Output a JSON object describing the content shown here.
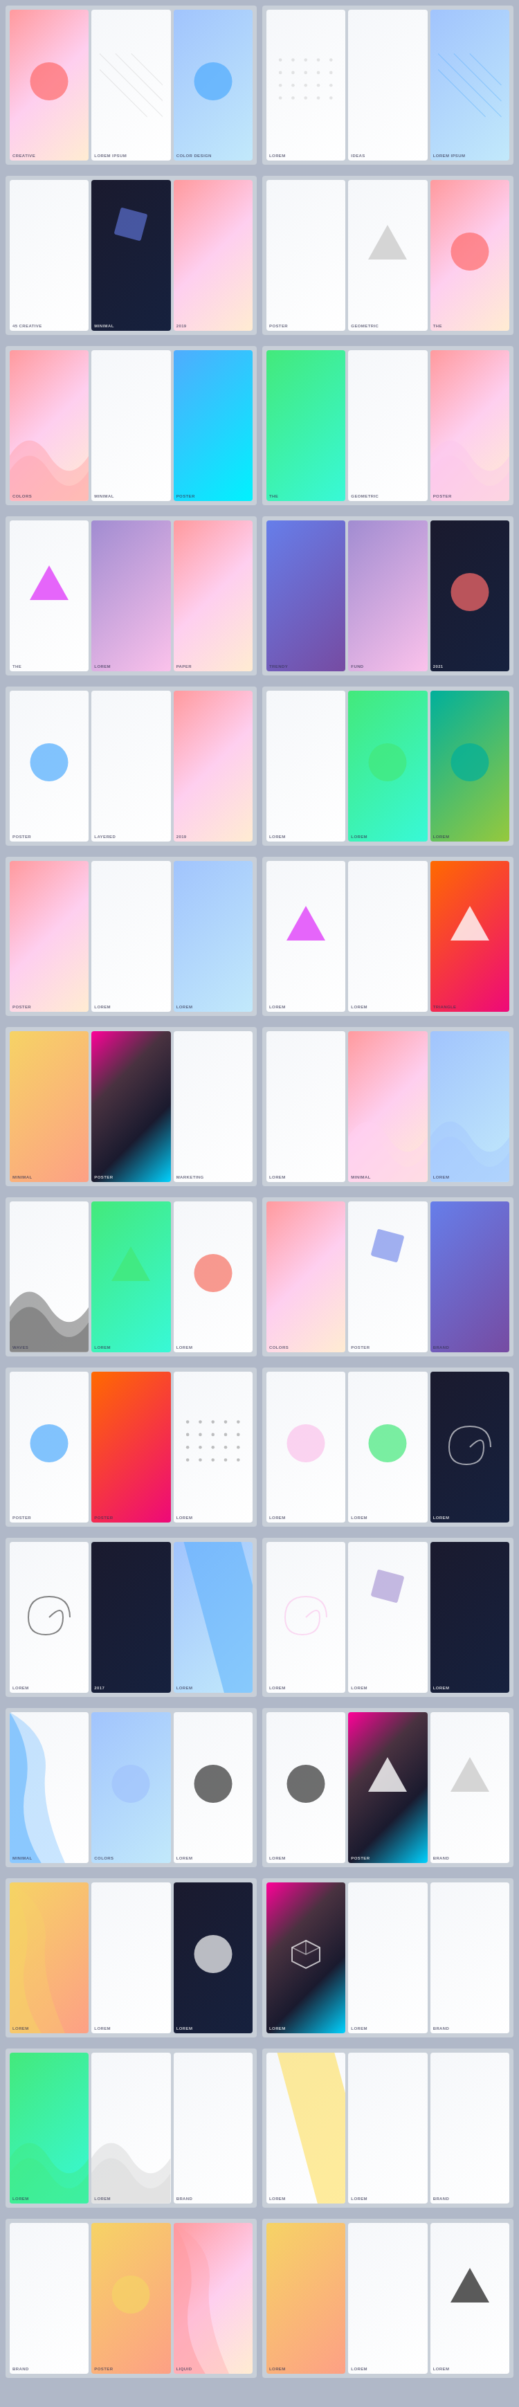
{
  "rows": [
    {
      "id": "row1",
      "cells": [
        {
          "id": "cell-1-1",
          "posters": [
            {
              "id": "p1",
              "label": "CREATIVE",
              "bg": "grad-warm",
              "shape": "circle",
              "shapeColor": "#ff6b6b"
            },
            {
              "id": "p2",
              "label": "LOREM IPSUM",
              "bg": "grad-light",
              "shape": "lines",
              "shapeColor": "#cccccc"
            },
            {
              "id": "p3",
              "label": "COLOR DESIGN",
              "bg": "grad-cool",
              "shape": "circle",
              "shapeColor": "#4facfe"
            }
          ]
        },
        {
          "id": "cell-1-2",
          "posters": [
            {
              "id": "p4",
              "label": "LOREM",
              "bg": "grad-light",
              "shape": "dots",
              "shapeColor": "#aaaaaa"
            },
            {
              "id": "p5",
              "label": "IDEAS",
              "bg": "grad-light",
              "shape": "none",
              "shapeColor": ""
            },
            {
              "id": "p6",
              "label": "LOREM IPSUM",
              "bg": "grad-cool",
              "shape": "lines",
              "shapeColor": "#4facfe"
            }
          ]
        }
      ]
    },
    {
      "id": "row2",
      "cells": [
        {
          "id": "cell-2-1",
          "posters": [
            {
              "id": "p7",
              "label": "45 CREATIVE",
              "bg": "grad-light",
              "shape": "none",
              "shapeColor": ""
            },
            {
              "id": "p8",
              "label": "MINIMAL",
              "bg": "grad-dark",
              "shape": "square",
              "shapeColor": "#667eea"
            },
            {
              "id": "p9",
              "label": "2019",
              "bg": "grad-warm",
              "shape": "none",
              "shapeColor": ""
            }
          ]
        },
        {
          "id": "cell-2-2",
          "posters": [
            {
              "id": "p10",
              "label": "POSTER",
              "bg": "grad-light",
              "shape": "none",
              "shapeColor": ""
            },
            {
              "id": "p11",
              "label": "GEOMETRIC",
              "bg": "grad-light",
              "shape": "triangle",
              "shapeColor": "#cccccc"
            },
            {
              "id": "p12",
              "label": "THE",
              "bg": "grad-warm",
              "shape": "circle",
              "shapeColor": "#ff6b6b"
            }
          ]
        }
      ]
    },
    {
      "id": "row3",
      "cells": [
        {
          "id": "cell-3-1",
          "posters": [
            {
              "id": "p13",
              "label": "COLORS",
              "bg": "grad-warm",
              "shape": "wave",
              "shapeColor": "#ff9a9e"
            },
            {
              "id": "p14",
              "label": "MINIMAL",
              "bg": "grad-light",
              "shape": "none",
              "shapeColor": ""
            },
            {
              "id": "p15",
              "label": "POSTER",
              "bg": "grad-blue",
              "shape": "none",
              "shapeColor": ""
            }
          ]
        },
        {
          "id": "cell-3-2",
          "posters": [
            {
              "id": "p16",
              "label": "THE",
              "bg": "grad-teal",
              "shape": "none",
              "shapeColor": ""
            },
            {
              "id": "p17",
              "label": "GEOMETRIC",
              "bg": "grad-light",
              "shape": "none",
              "shapeColor": ""
            },
            {
              "id": "p18",
              "label": "POSTER",
              "bg": "grad-warm",
              "shape": "wave",
              "shapeColor": "#fbc2eb"
            }
          ]
        }
      ]
    },
    {
      "id": "row4",
      "cells": [
        {
          "id": "cell-4-1",
          "posters": [
            {
              "id": "p19",
              "label": "THE",
              "bg": "grad-light",
              "shape": "triangle",
              "shapeColor": "#e040fb"
            },
            {
              "id": "p20",
              "label": "LOREM",
              "bg": "grad-purple",
              "shape": "none",
              "shapeColor": ""
            },
            {
              "id": "p21",
              "label": "PAPER",
              "bg": "grad-warm",
              "shape": "none",
              "shapeColor": ""
            }
          ]
        },
        {
          "id": "cell-4-2",
          "posters": [
            {
              "id": "p22",
              "label": "TRENDY",
              "bg": "grad-indigo",
              "shape": "none",
              "shapeColor": ""
            },
            {
              "id": "p23",
              "label": "FUND",
              "bg": "grad-purple",
              "shape": "none",
              "shapeColor": ""
            },
            {
              "id": "p24",
              "label": "2021",
              "bg": "grad-dark",
              "shape": "circle",
              "shapeColor": "#ff6b6b"
            }
          ]
        }
      ]
    },
    {
      "id": "row5",
      "cells": [
        {
          "id": "cell-5-1",
          "posters": [
            {
              "id": "p25",
              "label": "POSTER",
              "bg": "grad-light",
              "shape": "circle",
              "shapeColor": "#4facfe"
            },
            {
              "id": "p26",
              "label": "LAYERED",
              "bg": "grad-light",
              "shape": "none",
              "shapeColor": ""
            },
            {
              "id": "p27",
              "label": "2019",
              "bg": "grad-warm",
              "shape": "none",
              "shapeColor": ""
            }
          ]
        },
        {
          "id": "cell-5-2",
          "posters": [
            {
              "id": "p28",
              "label": "LOREM",
              "bg": "grad-light",
              "shape": "none",
              "shapeColor": ""
            },
            {
              "id": "p29",
              "label": "LOREM",
              "bg": "grad-teal",
              "shape": "circle",
              "shapeColor": "#43e97b"
            },
            {
              "id": "p30",
              "label": "LOREM",
              "bg": "grad-mint",
              "shape": "circle",
              "shapeColor": "#00b09b"
            }
          ]
        }
      ]
    },
    {
      "id": "row6",
      "cells": [
        {
          "id": "cell-6-1",
          "posters": [
            {
              "id": "p31",
              "label": "POSTER",
              "bg": "grad-warm",
              "shape": "none",
              "shapeColor": ""
            },
            {
              "id": "p32",
              "label": "LOREM",
              "bg": "grad-light",
              "shape": "none",
              "shapeColor": ""
            },
            {
              "id": "p33",
              "label": "LOREM",
              "bg": "grad-cool",
              "shape": "none",
              "shapeColor": ""
            }
          ]
        },
        {
          "id": "cell-6-2",
          "posters": [
            {
              "id": "p34",
              "label": "LOREM",
              "bg": "grad-light",
              "shape": "triangle",
              "shapeColor": "#e040fb"
            },
            {
              "id": "p35",
              "label": "LOREM",
              "bg": "grad-light",
              "shape": "none",
              "shapeColor": ""
            },
            {
              "id": "p36",
              "label": "TRIANGLE",
              "bg": "grad-coral",
              "shape": "triangle",
              "shapeColor": "#ffffff"
            }
          ]
        }
      ]
    },
    {
      "id": "row7",
      "cells": [
        {
          "id": "cell-7-1",
          "posters": [
            {
              "id": "p37",
              "label": "MINIMAL",
              "bg": "grad-yellow",
              "shape": "none",
              "shapeColor": ""
            },
            {
              "id": "p38",
              "label": "POSTER",
              "bg": "grad-rainbow",
              "shape": "none",
              "shapeColor": ""
            },
            {
              "id": "p39",
              "label": "MARKETING",
              "bg": "grad-light",
              "shape": "none",
              "shapeColor": ""
            }
          ]
        },
        {
          "id": "cell-7-2",
          "posters": [
            {
              "id": "p40",
              "label": "LOREM",
              "bg": "grad-light",
              "shape": "none",
              "shapeColor": ""
            },
            {
              "id": "p41",
              "label": "MINIMAL",
              "bg": "grad-warm",
              "shape": "wave",
              "shapeColor": "#fecfef"
            },
            {
              "id": "p42",
              "label": "LOREM",
              "bg": "grad-cool",
              "shape": "wave",
              "shapeColor": "#a1c4fd"
            }
          ]
        }
      ]
    },
    {
      "id": "row8",
      "cells": [
        {
          "id": "cell-8-1",
          "posters": [
            {
              "id": "p43",
              "label": "WAVES",
              "bg": "grad-light",
              "shape": "wave",
              "shapeColor": "#333333"
            },
            {
              "id": "p44",
              "label": "LOREM",
              "bg": "grad-teal",
              "shape": "triangle",
              "shapeColor": "#43e97b"
            },
            {
              "id": "p45",
              "label": "LOREM",
              "bg": "grad-light",
              "shape": "circle",
              "shapeColor": "#f77062"
            }
          ]
        },
        {
          "id": "cell-8-2",
          "posters": [
            {
              "id": "p46",
              "label": "COLORS",
              "bg": "grad-warm",
              "shape": "none",
              "shapeColor": ""
            },
            {
              "id": "p47",
              "label": "POSTER",
              "bg": "grad-light",
              "shape": "square",
              "shapeColor": "#667eea"
            },
            {
              "id": "p48",
              "label": "BRAND",
              "bg": "grad-indigo",
              "shape": "none",
              "shapeColor": ""
            }
          ]
        }
      ]
    },
    {
      "id": "row9",
      "cells": [
        {
          "id": "cell-9-1",
          "posters": [
            {
              "id": "p49",
              "label": "POSTER",
              "bg": "grad-light",
              "shape": "circle",
              "shapeColor": "#4facfe"
            },
            {
              "id": "p50",
              "label": "POSTER",
              "bg": "grad-coral",
              "shape": "none",
              "shapeColor": ""
            },
            {
              "id": "p51",
              "label": "LOREM",
              "bg": "grad-light",
              "shape": "dots",
              "shapeColor": "#333333"
            }
          ]
        },
        {
          "id": "cell-9-2",
          "posters": [
            {
              "id": "p52",
              "label": "LOREM",
              "bg": "grad-light",
              "shape": "circle",
              "shapeColor": "#fbc2eb"
            },
            {
              "id": "p53",
              "label": "LOREM",
              "bg": "grad-light",
              "shape": "circle",
              "shapeColor": "#43e97b"
            },
            {
              "id": "p54",
              "label": "LOREM",
              "bg": "grad-dark",
              "shape": "spiral",
              "shapeColor": "#ffffff"
            }
          ]
        }
      ]
    },
    {
      "id": "row10",
      "cells": [
        {
          "id": "cell-10-1",
          "posters": [
            {
              "id": "p55",
              "label": "LOREM",
              "bg": "grad-light",
              "shape": "spiral",
              "shapeColor": "#333333"
            },
            {
              "id": "p56",
              "label": "2017",
              "bg": "grad-dark",
              "shape": "none",
              "shapeColor": ""
            },
            {
              "id": "p57",
              "label": "LOREM",
              "bg": "grad-cool",
              "shape": "diagonal",
              "shapeColor": "#4facfe"
            }
          ]
        },
        {
          "id": "cell-10-2",
          "posters": [
            {
              "id": "p58",
              "label": "LOREM",
              "bg": "grad-light",
              "shape": "spiral",
              "shapeColor": "#fbc2eb"
            },
            {
              "id": "p59",
              "label": "LOREM",
              "bg": "grad-light",
              "shape": "square",
              "shapeColor": "#a18cd1"
            },
            {
              "id": "p60",
              "label": "LOREM",
              "bg": "grad-dark",
              "shape": "none",
              "shapeColor": ""
            }
          ]
        }
      ]
    },
    {
      "id": "row11",
      "cells": [
        {
          "id": "cell-11-1",
          "posters": [
            {
              "id": "p61",
              "label": "MINIMAL",
              "bg": "grad-light",
              "shape": "fluid",
              "shapeColor": "#4facfe"
            },
            {
              "id": "p62",
              "label": "COLORS",
              "bg": "grad-cool",
              "shape": "circle",
              "shapeColor": "#a1c4fd"
            },
            {
              "id": "p63",
              "label": "LOREM",
              "bg": "grad-light",
              "shape": "circle",
              "shapeColor": "#333333"
            }
          ]
        },
        {
          "id": "cell-11-2",
          "posters": [
            {
              "id": "p64",
              "label": "LOREM",
              "bg": "grad-light",
              "shape": "circle",
              "shapeColor": "#333333"
            },
            {
              "id": "p65",
              "label": "POSTER",
              "bg": "grad-rainbow",
              "shape": "triangle",
              "shapeColor": "#ffffff"
            },
            {
              "id": "p66",
              "label": "BRAND",
              "bg": "grad-light",
              "shape": "triangle",
              "shapeColor": "#cccccc"
            }
          ]
        }
      ]
    },
    {
      "id": "row12",
      "cells": [
        {
          "id": "cell-12-1",
          "posters": [
            {
              "id": "p67",
              "label": "LOREM",
              "bg": "grad-yellow",
              "shape": "fluid",
              "shapeColor": "#f6d365"
            },
            {
              "id": "p68",
              "label": "LOREM",
              "bg": "grad-light",
              "shape": "none",
              "shapeColor": ""
            },
            {
              "id": "p69",
              "label": "LOREM",
              "bg": "grad-dark",
              "shape": "circle",
              "shapeColor": "#ffffff"
            }
          ]
        },
        {
          "id": "cell-12-2",
          "posters": [
            {
              "id": "p70",
              "label": "LOREM",
              "bg": "grad-rainbow",
              "shape": "cube",
              "shapeColor": "#ffffff"
            },
            {
              "id": "p71",
              "label": "LOREM",
              "bg": "grad-light",
              "shape": "none",
              "shapeColor": ""
            },
            {
              "id": "p72",
              "label": "BRAND",
              "bg": "grad-light",
              "shape": "none",
              "shapeColor": ""
            }
          ]
        }
      ]
    },
    {
      "id": "row13",
      "cells": [
        {
          "id": "cell-13-1",
          "posters": [
            {
              "id": "p73",
              "label": "LOREM",
              "bg": "grad-teal",
              "shape": "wave",
              "shapeColor": "#43e97b"
            },
            {
              "id": "p74",
              "label": "LOREM",
              "bg": "grad-light",
              "shape": "wave",
              "shapeColor": "#cccccc"
            },
            {
              "id": "p75",
              "label": "BRAND",
              "bg": "grad-light",
              "shape": "none",
              "shapeColor": ""
            }
          ]
        },
        {
          "id": "cell-13-2",
          "posters": [
            {
              "id": "p76",
              "label": "LOREM",
              "bg": "grad-light",
              "shape": "diagonal",
              "shapeColor": "#ffd93d"
            },
            {
              "id": "p77",
              "label": "LOREM",
              "bg": "grad-light",
              "shape": "none",
              "shapeColor": ""
            },
            {
              "id": "p78",
              "label": "BRAND",
              "bg": "grad-light",
              "shape": "none",
              "shapeColor": ""
            }
          ]
        }
      ]
    },
    {
      "id": "row14",
      "cells": [
        {
          "id": "cell-14-1",
          "posters": [
            {
              "id": "p79",
              "label": "BRAND",
              "bg": "grad-light",
              "shape": "none",
              "shapeColor": ""
            },
            {
              "id": "p80",
              "label": "POSTER",
              "bg": "grad-yellow",
              "shape": "circle",
              "shapeColor": "#f6d365"
            },
            {
              "id": "p81",
              "label": "LIQUID",
              "bg": "grad-warm",
              "shape": "fluid",
              "shapeColor": "#ff9a9e"
            }
          ]
        },
        {
          "id": "cell-14-2",
          "posters": [
            {
              "id": "p82",
              "label": "LOREM",
              "bg": "grad-yellow",
              "shape": "none",
              "shapeColor": ""
            },
            {
              "id": "p83",
              "label": "LOREM",
              "bg": "grad-light",
              "shape": "none",
              "shapeColor": ""
            },
            {
              "id": "p84",
              "label": "LOREM",
              "bg": "grad-light",
              "shape": "triangle",
              "shapeColor": "#333333"
            }
          ]
        }
      ]
    }
  ],
  "accent": "#667eea",
  "bg": "#b0b8c8"
}
